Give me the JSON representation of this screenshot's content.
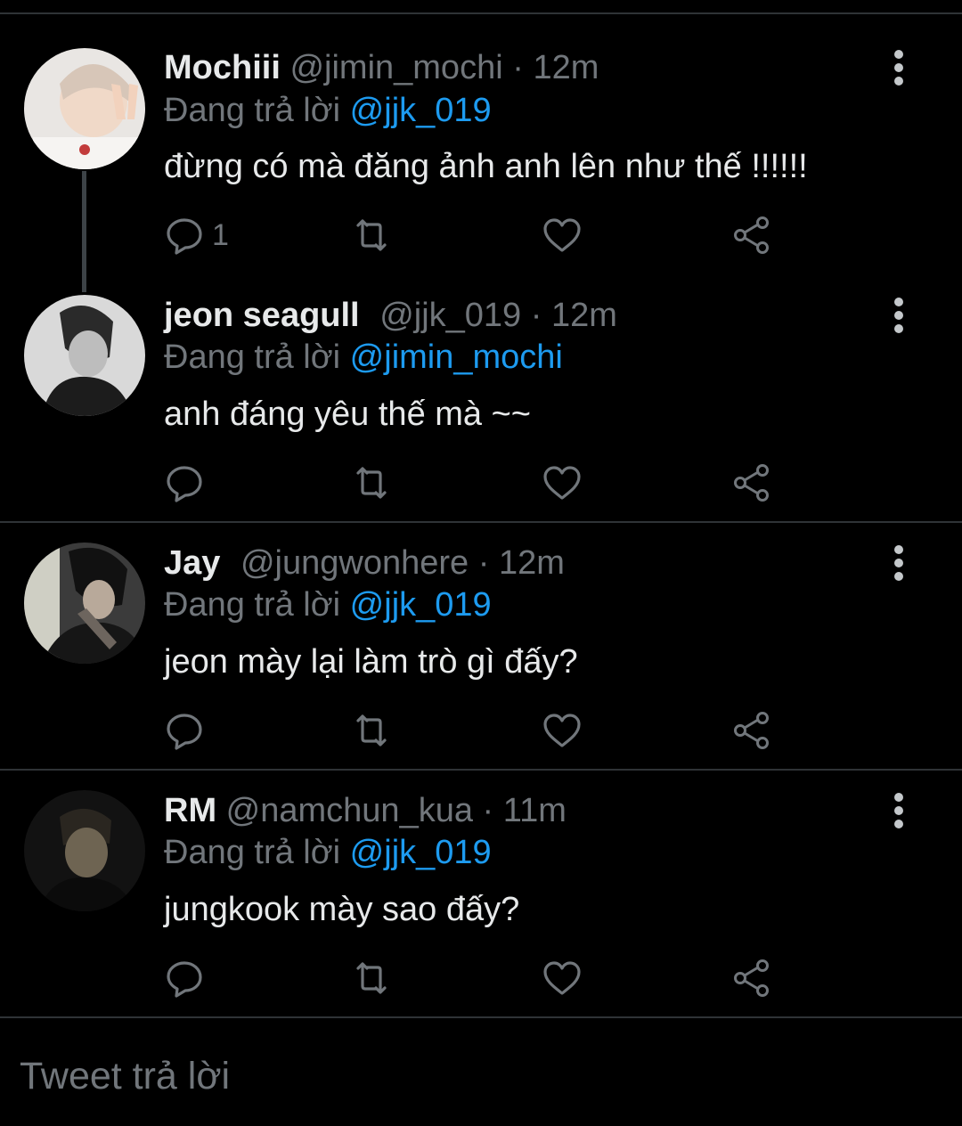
{
  "tweets": [
    {
      "name": "Mochiii",
      "handle": "@jimin_mochi",
      "time": "12m",
      "reply_prefix": "Đang trả lời",
      "reply_to": "@jjk_019",
      "text": "đừng có mà đăng ảnh anh lên như thế !!!!!!",
      "reply_count": "1",
      "avatar_icon": "avatar-photo"
    },
    {
      "name": "jeon seagull",
      "handle": "@jjk_019",
      "time": "12m",
      "reply_prefix": "Đang trả lời",
      "reply_to": "@jimin_mochi",
      "text": "anh đáng yêu thế mà ~~",
      "reply_count": "",
      "avatar_icon": "avatar-photo"
    },
    {
      "name": "Jay",
      "handle": "@jungwonhere",
      "time": "12m",
      "reply_prefix": "Đang trả lời",
      "reply_to": "@jjk_019",
      "text": "jeon mày lại làm trò gì đấy?",
      "reply_count": "",
      "avatar_icon": "avatar-photo"
    },
    {
      "name": "RM",
      "handle": "@namchun_kua",
      "time": "11m",
      "reply_prefix": "Đang trả lời",
      "reply_to": "@jjk_019",
      "text": "jungkook mày sao đấy?",
      "reply_count": "",
      "avatar_icon": "avatar-photo"
    }
  ],
  "separator": "·",
  "reply_bar": {
    "placeholder": "Tweet trả lời"
  },
  "icons": [
    "reply-icon",
    "retweet-icon",
    "like-icon",
    "share-icon",
    "more-icon"
  ],
  "colors": {
    "background": "#000000",
    "mention": "#1d9bf0",
    "muted": "#71767b",
    "text": "#e7e9ea",
    "divider": "#2f3336"
  }
}
